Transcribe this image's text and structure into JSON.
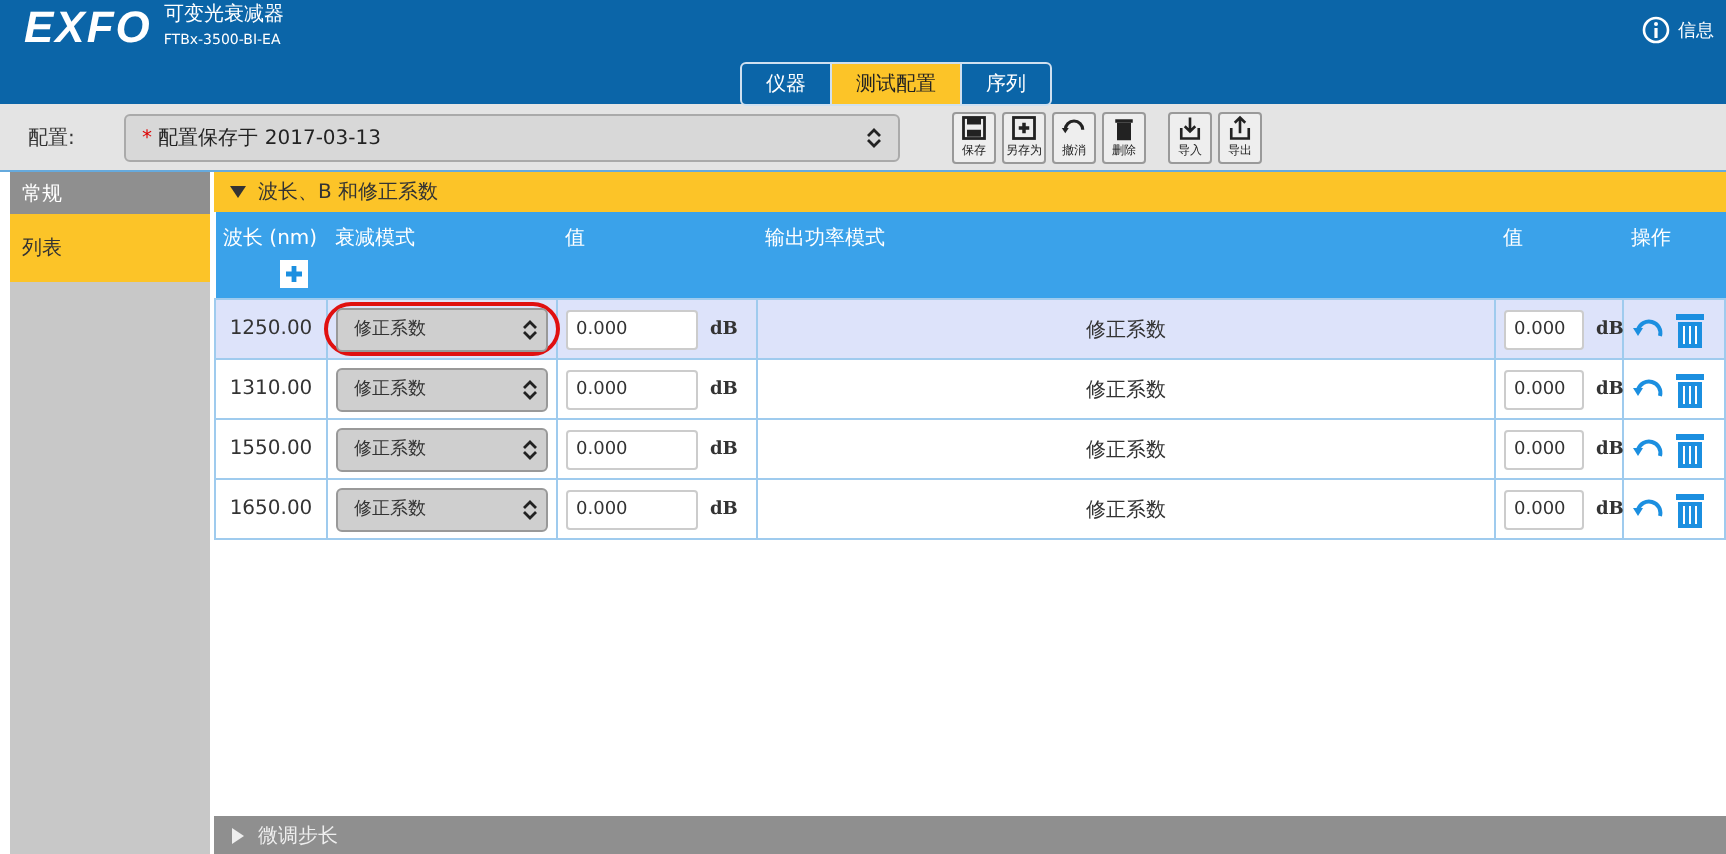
{
  "header": {
    "logo": "EXFO",
    "product": "可变光衰减器",
    "model": "FTBx-3500-BI-EA",
    "info": "信息"
  },
  "tabs": [
    {
      "label": "仪器",
      "selected": false
    },
    {
      "label": "测试配置",
      "selected": true
    },
    {
      "label": "序列",
      "selected": false
    }
  ],
  "config": {
    "label": "配置:",
    "modified_mark": "*",
    "value": "配置保存于 2017-03-13"
  },
  "toolbar": [
    {
      "kind": "save",
      "label": "保存"
    },
    {
      "kind": "saveas",
      "label": "另存为"
    },
    {
      "kind": "undo",
      "label": "撤消"
    },
    {
      "kind": "delete",
      "label": "删除"
    },
    {
      "kind": "import",
      "label": "导入"
    },
    {
      "kind": "export",
      "label": "导出"
    }
  ],
  "sidebar": {
    "items": [
      {
        "label": "常规",
        "selected": false
      },
      {
        "label": "列表",
        "selected": true
      }
    ]
  },
  "section": {
    "title": "波长、B 和修正系数",
    "expanded": true
  },
  "table": {
    "columns": [
      "波长 (nm)",
      "衰减模式",
      "值",
      "输出功率模式",
      "值",
      "操作"
    ],
    "rows": [
      {
        "wavelength": "1250.00",
        "mode": "修正系数",
        "value": "0.000",
        "unit": "dB",
        "output_mode": "修正系数",
        "output_value": "0.000",
        "output_unit": "dB",
        "selected": true,
        "highlighted": true
      },
      {
        "wavelength": "1310.00",
        "mode": "修正系数",
        "value": "0.000",
        "unit": "dB",
        "output_mode": "修正系数",
        "output_value": "0.000",
        "output_unit": "dB",
        "selected": false,
        "highlighted": false
      },
      {
        "wavelength": "1550.00",
        "mode": "修正系数",
        "value": "0.000",
        "unit": "dB",
        "output_mode": "修正系数",
        "output_value": "0.000",
        "output_unit": "dB",
        "selected": false,
        "highlighted": false
      },
      {
        "wavelength": "1650.00",
        "mode": "修正系数",
        "value": "0.000",
        "unit": "dB",
        "output_mode": "修正系数",
        "output_value": "0.000",
        "output_unit": "dB",
        "selected": false,
        "highlighted": false
      }
    ]
  },
  "footer_section": {
    "title": "微调步长",
    "expanded": false
  }
}
